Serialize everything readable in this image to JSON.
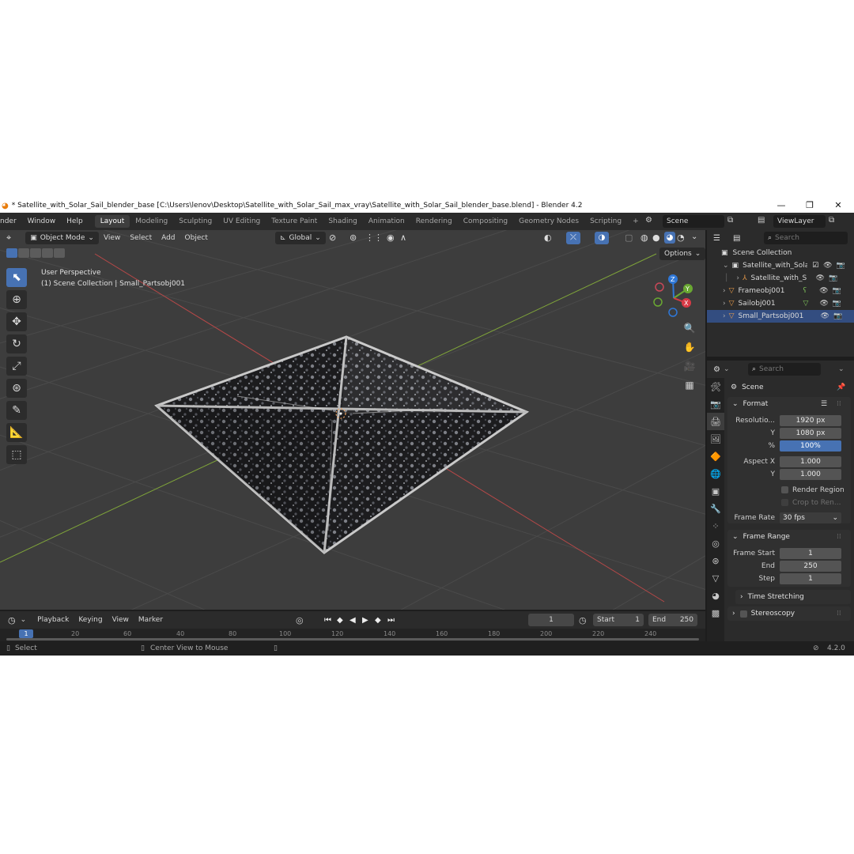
{
  "window": {
    "title": "* Satellite_with_Solar_Sail_blender_base [C:\\Users\\lenov\\Desktop\\Satellite_with_Solar_Sail_max_vray\\Satellite_with_Solar_Sail_blender_base.blend] - Blender 4.2",
    "minimize": "—",
    "maximize": "❐",
    "close": "✕"
  },
  "menu": [
    "nder",
    "Window",
    "Help"
  ],
  "workspaces": [
    {
      "label": "Layout",
      "active": true
    },
    {
      "label": "Modeling"
    },
    {
      "label": "Sculpting"
    },
    {
      "label": "UV Editing"
    },
    {
      "label": "Texture Paint"
    },
    {
      "label": "Shading"
    },
    {
      "label": "Animation"
    },
    {
      "label": "Rendering"
    },
    {
      "label": "Compositing"
    },
    {
      "label": "Geometry Nodes"
    },
    {
      "label": "Scripting"
    }
  ],
  "add_workspace": "+",
  "scene_field": "Scene",
  "viewlayer_field": "ViewLayer",
  "viewport": {
    "mode": "Object Mode",
    "menus": [
      "View",
      "Select",
      "Add",
      "Object"
    ],
    "transform_orientation": "Global",
    "options_label": "Options",
    "overlay_line1": "User Perspective",
    "overlay_line2": "(1) Scene Collection | Small_Partsobj001",
    "gizmo": {
      "z": "Z",
      "y": "Y",
      "x": "X"
    }
  },
  "timeline": {
    "menus": [
      "Playback",
      "Keying",
      "View",
      "Marker"
    ],
    "current_frame": "1",
    "start_label": "Start",
    "start_value": "1",
    "end_label": "End",
    "end_value": "250",
    "ruler": [
      "1",
      "20",
      "60",
      "40",
      "80",
      "100",
      "120",
      "140",
      "160",
      "180",
      "200",
      "220",
      "240"
    ]
  },
  "status": {
    "select": "Select",
    "center": "Center View to Mouse",
    "version": "4.2.0"
  },
  "outliner": {
    "search_placeholder": "Search",
    "items": [
      {
        "label": "Scene Collection",
        "indent": 0
      },
      {
        "label": "Satellite_with_Solar",
        "indent": 1
      },
      {
        "label": "Satellite_with_S",
        "indent": 2
      },
      {
        "label": "Frameobj001",
        "indent": 1
      },
      {
        "label": "Sailobj001",
        "indent": 1
      },
      {
        "label": "Small_Partsobj001",
        "indent": 1
      }
    ]
  },
  "properties": {
    "search_placeholder": "Search",
    "context": "Scene",
    "format_panel": "Format",
    "resolution_x_label": "Resolutio...",
    "resolution_x": "1920 px",
    "resolution_y_label": "Y",
    "resolution_y": "1080 px",
    "percent_label": "%",
    "percent": "100%",
    "aspect_x_label": "Aspect X",
    "aspect_x": "1.000",
    "aspect_y_label": "Y",
    "aspect_y": "1.000",
    "render_region": "Render Region",
    "crop": "Crop to Ren...",
    "frame_rate_label": "Frame Rate",
    "frame_rate": "30 fps",
    "frame_range_panel": "Frame Range",
    "frame_start_label": "Frame Start",
    "frame_start": "1",
    "end_label": "End",
    "end": "250",
    "step_label": "Step",
    "step": "1",
    "time_stretching": "Time Stretching",
    "stereoscopy": "Stereoscopy"
  },
  "colors": {
    "accent": "#4772b3",
    "axis_x": "#c84848",
    "axis_y": "#8ab03a",
    "gizmo_z": "#2f78d8",
    "gizmo_y": "#6aa832",
    "gizmo_x": "#d83a46"
  }
}
